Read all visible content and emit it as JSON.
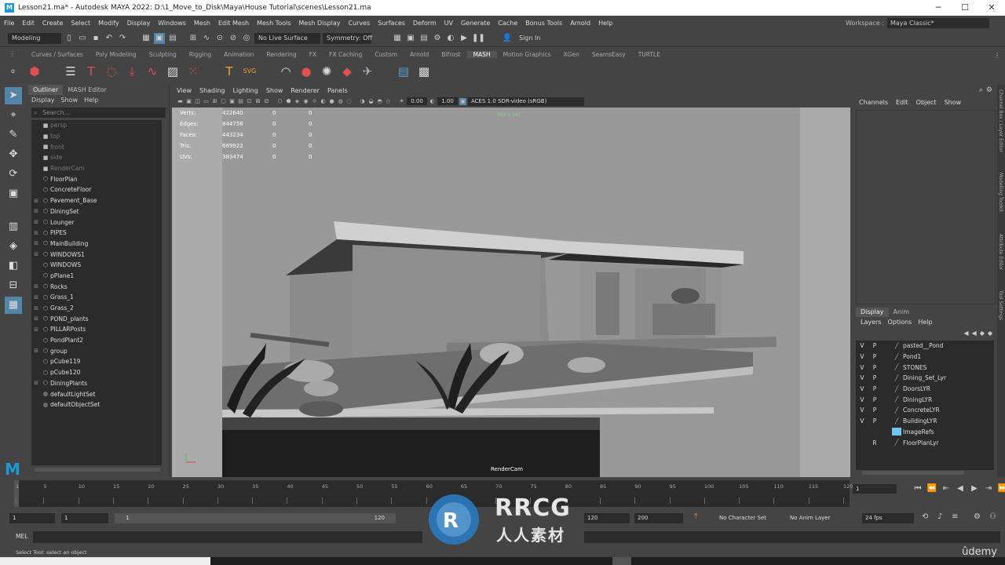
{
  "title_bar": {
    "title": "Lesson21.ma* - Autodesk MAYA 2022: D:\\1_Move_to_Disk\\Maya\\House Tutorial\\scenes\\Lesson21.ma"
  },
  "menu": [
    "File",
    "Edit",
    "Create",
    "Select",
    "Modify",
    "Display",
    "Windows",
    "Mesh",
    "Edit Mesh",
    "Mesh Tools",
    "Mesh Display",
    "Curves",
    "Surfaces",
    "Deform",
    "UV",
    "Generate",
    "Cache",
    "Bonus Tools",
    "Arnold",
    "Help"
  ],
  "workspace": {
    "label": "Workspace :",
    "value": "Maya Classic*"
  },
  "status": {
    "mode": "Modeling",
    "live_surface": "No Live Surface",
    "symmetry": "Symmetry: Off",
    "sign_in": "Sign In"
  },
  "shelf_tabs": [
    "Curves / Surfaces",
    "Poly Modeling",
    "Sculpting",
    "Rigging",
    "Animation",
    "Rendering",
    "FX",
    "FX Caching",
    "Custom",
    "Arnold",
    "Bifrost",
    "MASH",
    "Motion Graphics",
    "XGen",
    "SeamsEasy",
    "TURTLE"
  ],
  "outliner": {
    "tabs": [
      "Outliner",
      "MASH Editor"
    ],
    "menus": [
      "Display",
      "Show",
      "Help"
    ],
    "search_placeholder": "Search...",
    "items": [
      {
        "label": "persp",
        "dim": true,
        "exp": ""
      },
      {
        "label": "top",
        "dim": true,
        "exp": ""
      },
      {
        "label": "front",
        "dim": true,
        "exp": ""
      },
      {
        "label": "side",
        "dim": true,
        "exp": ""
      },
      {
        "label": "RenderCam",
        "dim": true,
        "exp": ""
      },
      {
        "label": "FloorPlan",
        "dim": false,
        "exp": ""
      },
      {
        "label": "ConcreteFloor",
        "dim": false,
        "exp": ""
      },
      {
        "label": "Pavement_Base",
        "dim": false,
        "exp": "+"
      },
      {
        "label": "DiningSet",
        "dim": false,
        "exp": "+"
      },
      {
        "label": "Lounger",
        "dim": false,
        "exp": "+"
      },
      {
        "label": "PIPES",
        "dim": false,
        "exp": "+"
      },
      {
        "label": "MainBuilding",
        "dim": false,
        "exp": "+"
      },
      {
        "label": "WINDOWS1",
        "dim": false,
        "exp": "+"
      },
      {
        "label": "WINDOWS",
        "dim": false,
        "exp": ""
      },
      {
        "label": "pPlane1",
        "dim": false,
        "exp": ""
      },
      {
        "label": "Rocks",
        "dim": false,
        "exp": "+"
      },
      {
        "label": "Grass_1",
        "dim": false,
        "exp": "+"
      },
      {
        "label": "Grass_2",
        "dim": false,
        "exp": "+"
      },
      {
        "label": "POND_plants",
        "dim": false,
        "exp": "+"
      },
      {
        "label": "PILLARPosts",
        "dim": false,
        "exp": "+"
      },
      {
        "label": "PondPlant2",
        "dim": false,
        "exp": ""
      },
      {
        "label": "group",
        "dim": false,
        "exp": "+"
      },
      {
        "label": "pCube119",
        "dim": false,
        "exp": ""
      },
      {
        "label": "pCube120",
        "dim": false,
        "exp": ""
      },
      {
        "label": "DiningPlants",
        "dim": false,
        "exp": "+"
      },
      {
        "label": "defaultLightSet",
        "dim": false,
        "exp": ""
      },
      {
        "label": "defaultObjectSet",
        "dim": false,
        "exp": ""
      }
    ]
  },
  "viewport": {
    "menus": [
      "View",
      "Shading",
      "Lighting",
      "Show",
      "Renderer",
      "Panels"
    ],
    "exposure": "0.00",
    "gamma": "1.00",
    "color_space": "ACES 1.0 SDR-video (sRGB)",
    "hud": [
      {
        "label": "Verts:",
        "v": "422640",
        "a": "0",
        "b": "0"
      },
      {
        "label": "Edges:",
        "v": "844756",
        "a": "0",
        "b": "0"
      },
      {
        "label": "Faces:",
        "v": "443234",
        "a": "0",
        "b": "0"
      },
      {
        "label": "Tris:",
        "v": "669922",
        "a": "0",
        "b": "0"
      },
      {
        "label": "UVs:",
        "v": "383474",
        "a": "0",
        "b": "0"
      }
    ],
    "resolution": "960 x 540",
    "camera": "RenderCam"
  },
  "channel_box": {
    "menus": [
      "Channels",
      "Edit",
      "Object",
      "Show"
    ]
  },
  "layers": {
    "tabs": [
      "Display",
      "Anim"
    ],
    "menus": [
      "Layers",
      "Options",
      "Help"
    ],
    "rows": [
      {
        "v": "V",
        "p": "P",
        "name": "pasted__Pond"
      },
      {
        "v": "V",
        "p": "P",
        "name": "Pond1"
      },
      {
        "v": "V",
        "p": "P",
        "name": "STONES"
      },
      {
        "v": "V",
        "p": "P",
        "name": "Dining_Set_Lyr"
      },
      {
        "v": "V",
        "p": "P",
        "name": "DoorsLYR"
      },
      {
        "v": "V",
        "p": "P",
        "name": "DiningLYR"
      },
      {
        "v": "V",
        "p": "P",
        "name": "ConcreteLYR"
      },
      {
        "v": "V",
        "p": "P",
        "name": "BuildingLYR"
      },
      {
        "v": "",
        "p": "",
        "name": "ImageRefs"
      },
      {
        "v": "",
        "p": "R",
        "name": "FloorPlanLyr"
      }
    ]
  },
  "side_tabs": [
    "Channel Box / Layer Editor",
    "Modelling Toolkit",
    "Attribute Editor",
    "Tool Settings"
  ],
  "timeline": {
    "ticks": [
      "1",
      "5",
      "10",
      "15",
      "20",
      "25",
      "30",
      "35",
      "40",
      "45",
      "50",
      "55",
      "60",
      "65",
      "70",
      "75",
      "80",
      "85",
      "90",
      "95",
      "100",
      "105",
      "110",
      "115",
      "120"
    ],
    "current_frame": "1"
  },
  "range": {
    "start": "1",
    "start2": "1",
    "slider_start": "1",
    "slider_end": "120",
    "end": "120",
    "end2": "200",
    "character_set": "No Character Set",
    "anim_layer": "No Anim Layer",
    "fps": "24 fps"
  },
  "cmd": {
    "label": "MEL"
  },
  "help": {
    "text": "Select Tool: select an object"
  },
  "watermark": {
    "brand": "RRCG",
    "sub": "人人素材"
  },
  "brand": "ûdemy",
  "colors": {
    "accent": "#5285a6",
    "maya_logo": "#1a9ad6",
    "watermark_blue": "#2b7bbf"
  }
}
